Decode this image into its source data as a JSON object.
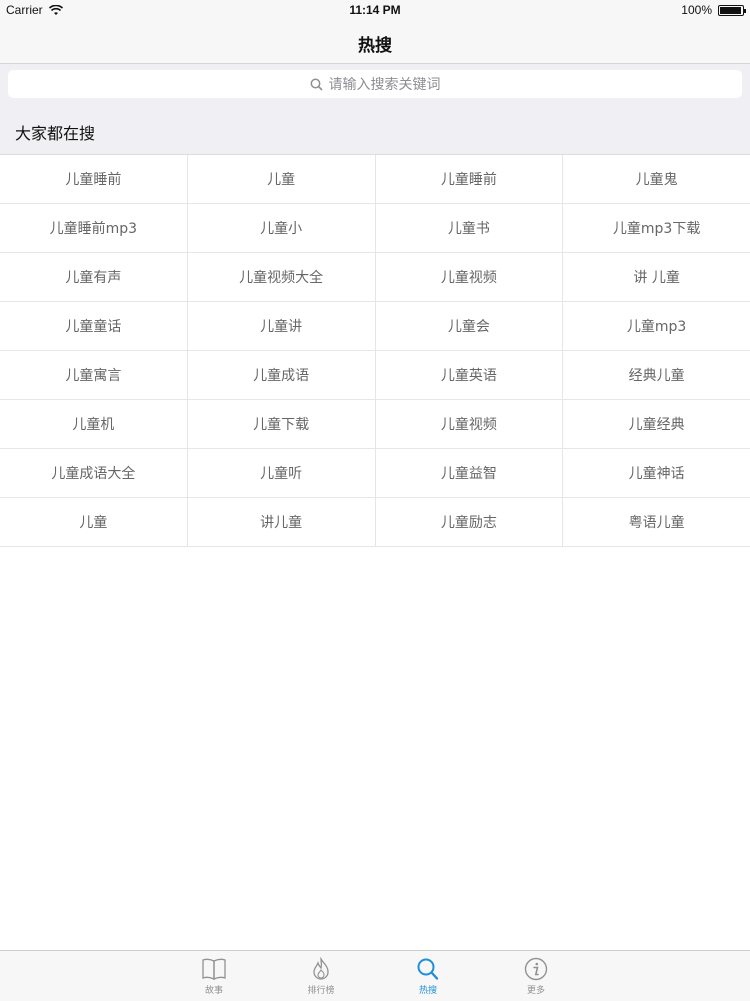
{
  "status_bar": {
    "carrier": "Carrier",
    "time": "11:14 PM",
    "battery": "100%"
  },
  "nav": {
    "title": "热搜"
  },
  "search": {
    "placeholder": "请输入搜索关键词"
  },
  "section": {
    "title": "大家都在搜"
  },
  "grid": {
    "rows": [
      [
        "儿童睡前",
        "儿童",
        "儿童睡前",
        "儿童鬼"
      ],
      [
        "儿童睡前mp3",
        "儿童小",
        "儿童书",
        "儿童mp3下载"
      ],
      [
        "儿童有声",
        "儿童视频大全",
        "儿童视频",
        "讲 儿童"
      ],
      [
        "儿童童话",
        "儿童讲",
        "儿童会",
        "儿童mp3"
      ],
      [
        "儿童寓言",
        "儿童成语",
        "儿童英语",
        "经典儿童"
      ],
      [
        "儿童机",
        "儿童下载",
        "儿童视频",
        "儿童经典"
      ],
      [
        "儿童成语大全",
        "儿童听",
        "儿童益智",
        "儿童神话"
      ],
      [
        "儿童",
        "讲儿童",
        "儿童励志",
        "粤语儿童"
      ]
    ]
  },
  "tab_bar": {
    "tabs": [
      {
        "label": "故事",
        "icon": "book-icon"
      },
      {
        "label": "排行榜",
        "icon": "flame-icon"
      },
      {
        "label": "热搜",
        "icon": "search-icon",
        "active": true
      },
      {
        "label": "更多",
        "icon": "info-icon"
      }
    ]
  },
  "colors": {
    "accent": "#1e90d8",
    "tab_inactive": "#929292"
  }
}
